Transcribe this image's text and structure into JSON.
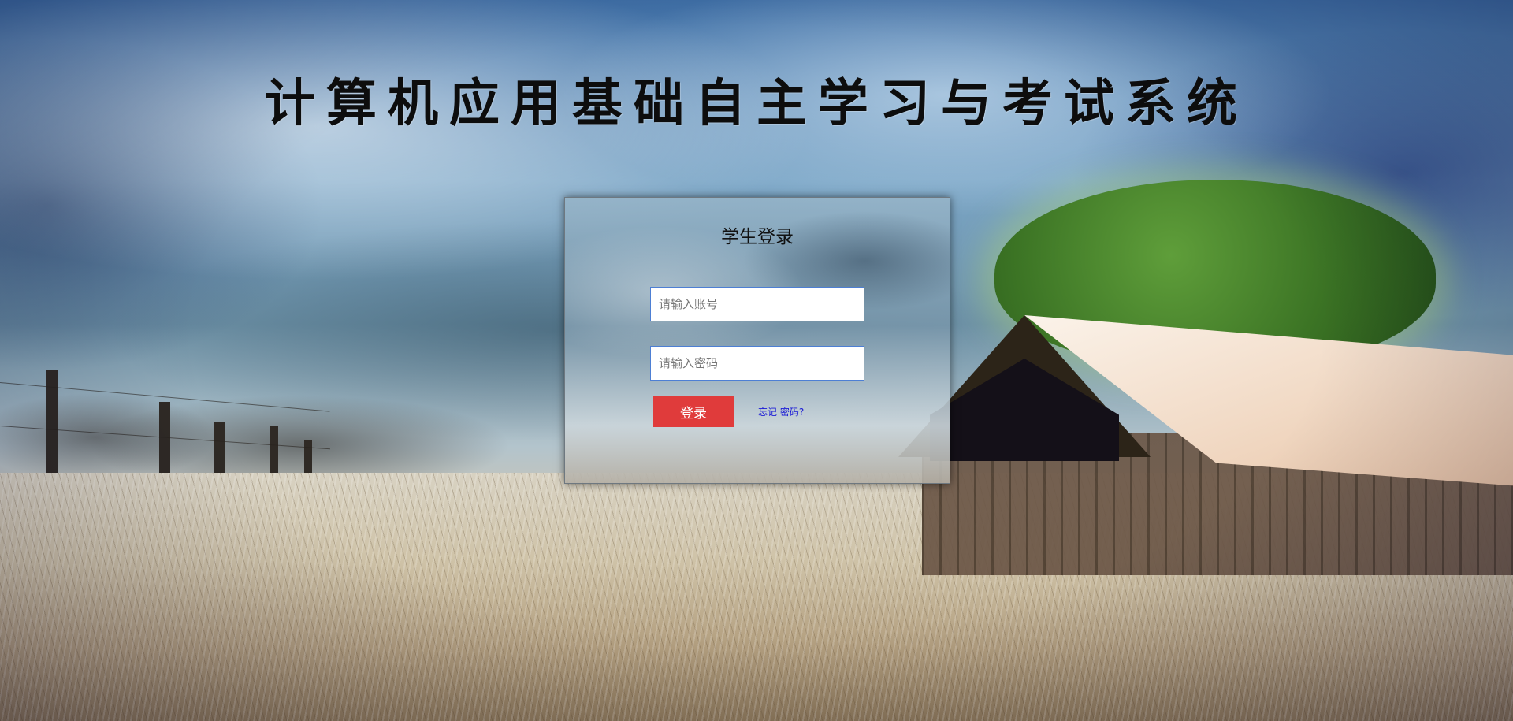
{
  "page": {
    "title": "计算机应用基础自主学习与考试系统"
  },
  "login": {
    "title": "学生登录",
    "account_placeholder": "请输入账号",
    "password_placeholder": "请输入密码",
    "submit_label": "登录",
    "forgot_label": "忘记 密码?"
  },
  "colors": {
    "submit_button": "#e03b3b",
    "forgot_link": "#1a1ad6",
    "input_border": "#4d7fd4"
  }
}
